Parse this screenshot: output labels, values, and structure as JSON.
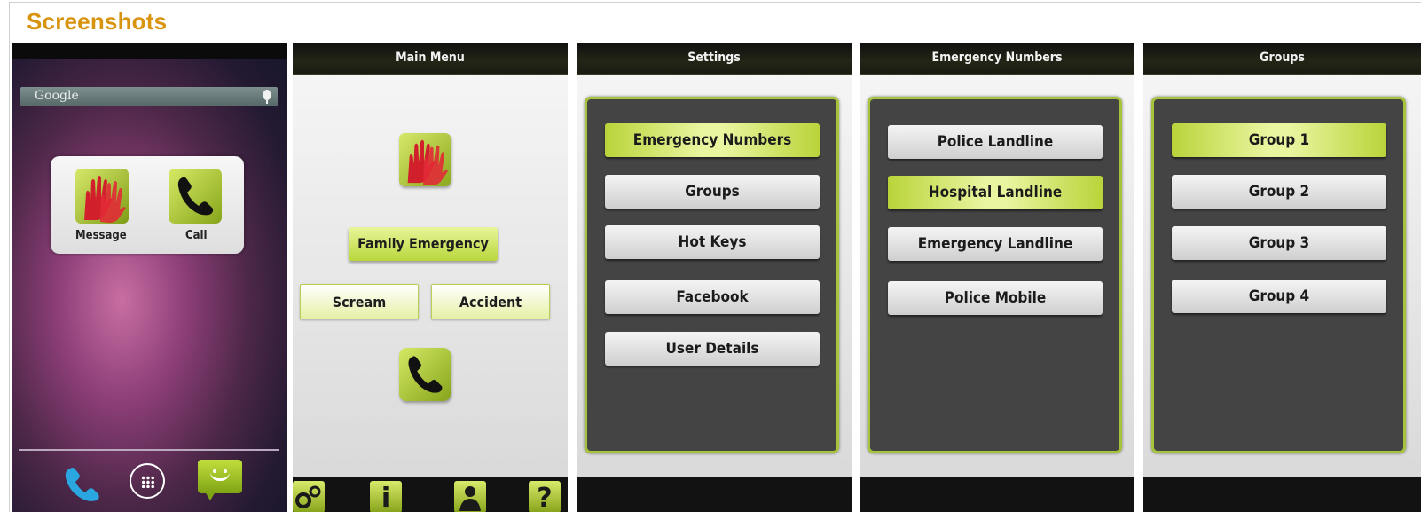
{
  "section_title": "Screenshots",
  "home": {
    "search_label": "Google",
    "widget": {
      "message_label": "Message",
      "call_label": "Call"
    }
  },
  "main_menu": {
    "title": "Main Menu",
    "family_emergency": "Family  Emergency",
    "scream": "Scream",
    "accident": "Accident",
    "bottom_icons": [
      "settings-icon",
      "info-icon",
      "contacts-icon",
      "help-icon"
    ]
  },
  "settings": {
    "title": "Settings",
    "items": [
      "Emergency Numbers",
      "Groups",
      "Hot Keys",
      "Facebook",
      "User Details"
    ],
    "selected": "Emergency Numbers"
  },
  "emergency_numbers": {
    "title": "Emergency Numbers",
    "items": [
      "Police Landline",
      "Hospital Landline",
      "Emergency Landline",
      "Police Mobile"
    ],
    "selected": "Hospital Landline"
  },
  "groups": {
    "title": "Groups",
    "items": [
      "Group 1",
      "Group 2",
      "Group 3",
      "Group 4"
    ],
    "selected": "Group 1"
  },
  "colors": {
    "title_orange": "#d8940f",
    "accent_green": "#b8d73a",
    "dark_card": "#444444"
  }
}
